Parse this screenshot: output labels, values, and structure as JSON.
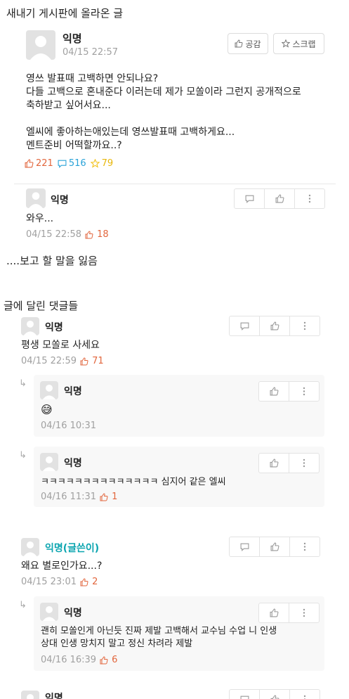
{
  "caption_top": "새내기 게시판에 올라온 글",
  "post": {
    "author": "익명",
    "date": "04/15 22:57",
    "like_button": "공감",
    "scrap_button": "스크랩",
    "title": "영쓰 발표때 고백하면 안되나요?",
    "body_lines": [
      "다들 고백으로 혼내준다 이러는데 제가 모쏠이라 그런지 공개적으로",
      "축하받고 싶어서요...",
      "",
      "엘씨에 좋아하는애있는데 영쓰발표때 고백하게요...",
      "멘트준비 어떡할까요..?"
    ],
    "likes": "221",
    "comments": "516",
    "scraps": "79"
  },
  "first_comment": {
    "author": "익명",
    "text": "와우...",
    "date": "04/15 22:58",
    "likes": "18"
  },
  "caption_middle": "....보고 할 말을 잃음",
  "caption_comments": "글에 달린 댓글들",
  "comments": [
    {
      "author": "익명",
      "text": "평생 모쏠로 사세요",
      "date": "04/15 22:59",
      "likes": "71",
      "replies": [
        {
          "author": "익명",
          "emoji": "😅",
          "date": "04/16 10:31"
        },
        {
          "author": "익명",
          "text": "ㅋㅋㅋㅋㅋㅋㅋㅋㅋㅋㅋㅋㅋㅋ 심지어 같은 엘씨",
          "date": "04/16 11:31",
          "likes": "1"
        }
      ]
    },
    {
      "author": "익명(글쓴이)",
      "text": "왜요 별로인가요...?",
      "date": "04/15 23:01",
      "likes": "2",
      "replies": [
        {
          "author": "익명",
          "lines": [
            "괜히 모쏠인게 아닌듯 진짜 제발 고백해서 교수님 수업 니 인생",
            "상대 인생 망치지 말고 정신 차려라 제발"
          ],
          "date": "04/16 16:39",
          "likes": "6"
        }
      ]
    },
    {
      "author": "익명"
    }
  ],
  "icons": {
    "like": "thumbs-up-icon",
    "comment": "speech-bubble-icon",
    "scrap": "star-icon",
    "more": "more-vertical-icon",
    "reply": "reply-arrow-icon",
    "avatar": "default-avatar"
  },
  "colors": {
    "like": "#e2663d",
    "comment": "#2aa3d8",
    "scrap": "#f2c21a",
    "writer": "#0ca5b0",
    "meta": "#a0a0a0"
  }
}
